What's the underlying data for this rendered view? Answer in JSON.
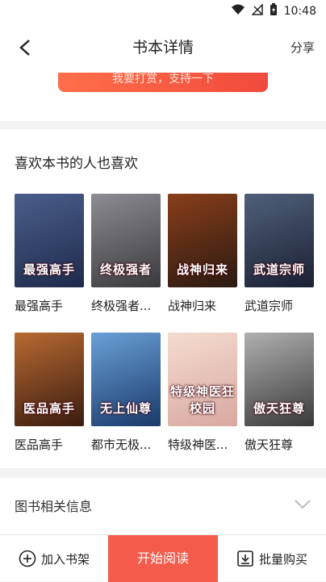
{
  "status_bar": {
    "time": "10:48"
  },
  "nav": {
    "title": "书本详情",
    "share_label": "分享"
  },
  "support": {
    "button_label": "我要打赏，支持一下"
  },
  "recommend": {
    "title": "喜欢本书的人也喜欢",
    "books": [
      {
        "title": "最强高手",
        "cover_text": "最强高手",
        "cover_colors": [
          "#1d2a4a",
          "#4b5e8c"
        ]
      },
      {
        "title": "终极强者...",
        "cover_text": "终极强者",
        "cover_colors": [
          "#3a3a3e",
          "#8c8c92"
        ]
      },
      {
        "title": "战神归来",
        "cover_text": "战神归来",
        "cover_colors": [
          "#2a1a12",
          "#8a3e1a"
        ]
      },
      {
        "title": "武道宗师",
        "cover_text": "武道宗师",
        "cover_colors": [
          "#1a2034",
          "#50607a"
        ]
      },
      {
        "title": "医品高手",
        "cover_text": "医品高手",
        "cover_colors": [
          "#3a1c10",
          "#b86a32"
        ]
      },
      {
        "title": "都市无极...",
        "cover_text": "无上仙尊",
        "cover_colors": [
          "#1a3a6a",
          "#6aa0d8"
        ]
      },
      {
        "title": "特级神医...",
        "cover_text": "特级神医狂校园",
        "cover_colors": [
          "#d8a8a0",
          "#f4dcd0"
        ]
      },
      {
        "title": "傲天狂尊",
        "cover_text": "傲天狂尊",
        "cover_colors": [
          "#3a3a3a",
          "#b0b0b0"
        ]
      }
    ]
  },
  "info": {
    "label": "图书相关信息"
  },
  "bottom_bar": {
    "add_label": "加入书架",
    "read_label": "开始阅读",
    "bulk_label": "批量购买"
  }
}
